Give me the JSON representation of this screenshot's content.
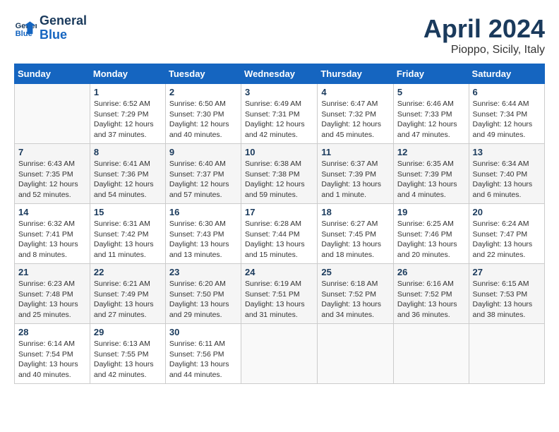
{
  "header": {
    "logo_line1": "General",
    "logo_line2": "Blue",
    "month": "April 2024",
    "location": "Pioppo, Sicily, Italy"
  },
  "days_of_week": [
    "Sunday",
    "Monday",
    "Tuesday",
    "Wednesday",
    "Thursday",
    "Friday",
    "Saturday"
  ],
  "weeks": [
    [
      {
        "day": "",
        "content": ""
      },
      {
        "day": "1",
        "content": "Sunrise: 6:52 AM\nSunset: 7:29 PM\nDaylight: 12 hours\nand 37 minutes."
      },
      {
        "day": "2",
        "content": "Sunrise: 6:50 AM\nSunset: 7:30 PM\nDaylight: 12 hours\nand 40 minutes."
      },
      {
        "day": "3",
        "content": "Sunrise: 6:49 AM\nSunset: 7:31 PM\nDaylight: 12 hours\nand 42 minutes."
      },
      {
        "day": "4",
        "content": "Sunrise: 6:47 AM\nSunset: 7:32 PM\nDaylight: 12 hours\nand 45 minutes."
      },
      {
        "day": "5",
        "content": "Sunrise: 6:46 AM\nSunset: 7:33 PM\nDaylight: 12 hours\nand 47 minutes."
      },
      {
        "day": "6",
        "content": "Sunrise: 6:44 AM\nSunset: 7:34 PM\nDaylight: 12 hours\nand 49 minutes."
      }
    ],
    [
      {
        "day": "7",
        "content": "Sunrise: 6:43 AM\nSunset: 7:35 PM\nDaylight: 12 hours\nand 52 minutes."
      },
      {
        "day": "8",
        "content": "Sunrise: 6:41 AM\nSunset: 7:36 PM\nDaylight: 12 hours\nand 54 minutes."
      },
      {
        "day": "9",
        "content": "Sunrise: 6:40 AM\nSunset: 7:37 PM\nDaylight: 12 hours\nand 57 minutes."
      },
      {
        "day": "10",
        "content": "Sunrise: 6:38 AM\nSunset: 7:38 PM\nDaylight: 12 hours\nand 59 minutes."
      },
      {
        "day": "11",
        "content": "Sunrise: 6:37 AM\nSunset: 7:39 PM\nDaylight: 13 hours\nand 1 minute."
      },
      {
        "day": "12",
        "content": "Sunrise: 6:35 AM\nSunset: 7:39 PM\nDaylight: 13 hours\nand 4 minutes."
      },
      {
        "day": "13",
        "content": "Sunrise: 6:34 AM\nSunset: 7:40 PM\nDaylight: 13 hours\nand 6 minutes."
      }
    ],
    [
      {
        "day": "14",
        "content": "Sunrise: 6:32 AM\nSunset: 7:41 PM\nDaylight: 13 hours\nand 8 minutes."
      },
      {
        "day": "15",
        "content": "Sunrise: 6:31 AM\nSunset: 7:42 PM\nDaylight: 13 hours\nand 11 minutes."
      },
      {
        "day": "16",
        "content": "Sunrise: 6:30 AM\nSunset: 7:43 PM\nDaylight: 13 hours\nand 13 minutes."
      },
      {
        "day": "17",
        "content": "Sunrise: 6:28 AM\nSunset: 7:44 PM\nDaylight: 13 hours\nand 15 minutes."
      },
      {
        "day": "18",
        "content": "Sunrise: 6:27 AM\nSunset: 7:45 PM\nDaylight: 13 hours\nand 18 minutes."
      },
      {
        "day": "19",
        "content": "Sunrise: 6:25 AM\nSunset: 7:46 PM\nDaylight: 13 hours\nand 20 minutes."
      },
      {
        "day": "20",
        "content": "Sunrise: 6:24 AM\nSunset: 7:47 PM\nDaylight: 13 hours\nand 22 minutes."
      }
    ],
    [
      {
        "day": "21",
        "content": "Sunrise: 6:23 AM\nSunset: 7:48 PM\nDaylight: 13 hours\nand 25 minutes."
      },
      {
        "day": "22",
        "content": "Sunrise: 6:21 AM\nSunset: 7:49 PM\nDaylight: 13 hours\nand 27 minutes."
      },
      {
        "day": "23",
        "content": "Sunrise: 6:20 AM\nSunset: 7:50 PM\nDaylight: 13 hours\nand 29 minutes."
      },
      {
        "day": "24",
        "content": "Sunrise: 6:19 AM\nSunset: 7:51 PM\nDaylight: 13 hours\nand 31 minutes."
      },
      {
        "day": "25",
        "content": "Sunrise: 6:18 AM\nSunset: 7:52 PM\nDaylight: 13 hours\nand 34 minutes."
      },
      {
        "day": "26",
        "content": "Sunrise: 6:16 AM\nSunset: 7:52 PM\nDaylight: 13 hours\nand 36 minutes."
      },
      {
        "day": "27",
        "content": "Sunrise: 6:15 AM\nSunset: 7:53 PM\nDaylight: 13 hours\nand 38 minutes."
      }
    ],
    [
      {
        "day": "28",
        "content": "Sunrise: 6:14 AM\nSunset: 7:54 PM\nDaylight: 13 hours\nand 40 minutes."
      },
      {
        "day": "29",
        "content": "Sunrise: 6:13 AM\nSunset: 7:55 PM\nDaylight: 13 hours\nand 42 minutes."
      },
      {
        "day": "30",
        "content": "Sunrise: 6:11 AM\nSunset: 7:56 PM\nDaylight: 13 hours\nand 44 minutes."
      },
      {
        "day": "",
        "content": ""
      },
      {
        "day": "",
        "content": ""
      },
      {
        "day": "",
        "content": ""
      },
      {
        "day": "",
        "content": ""
      }
    ]
  ]
}
